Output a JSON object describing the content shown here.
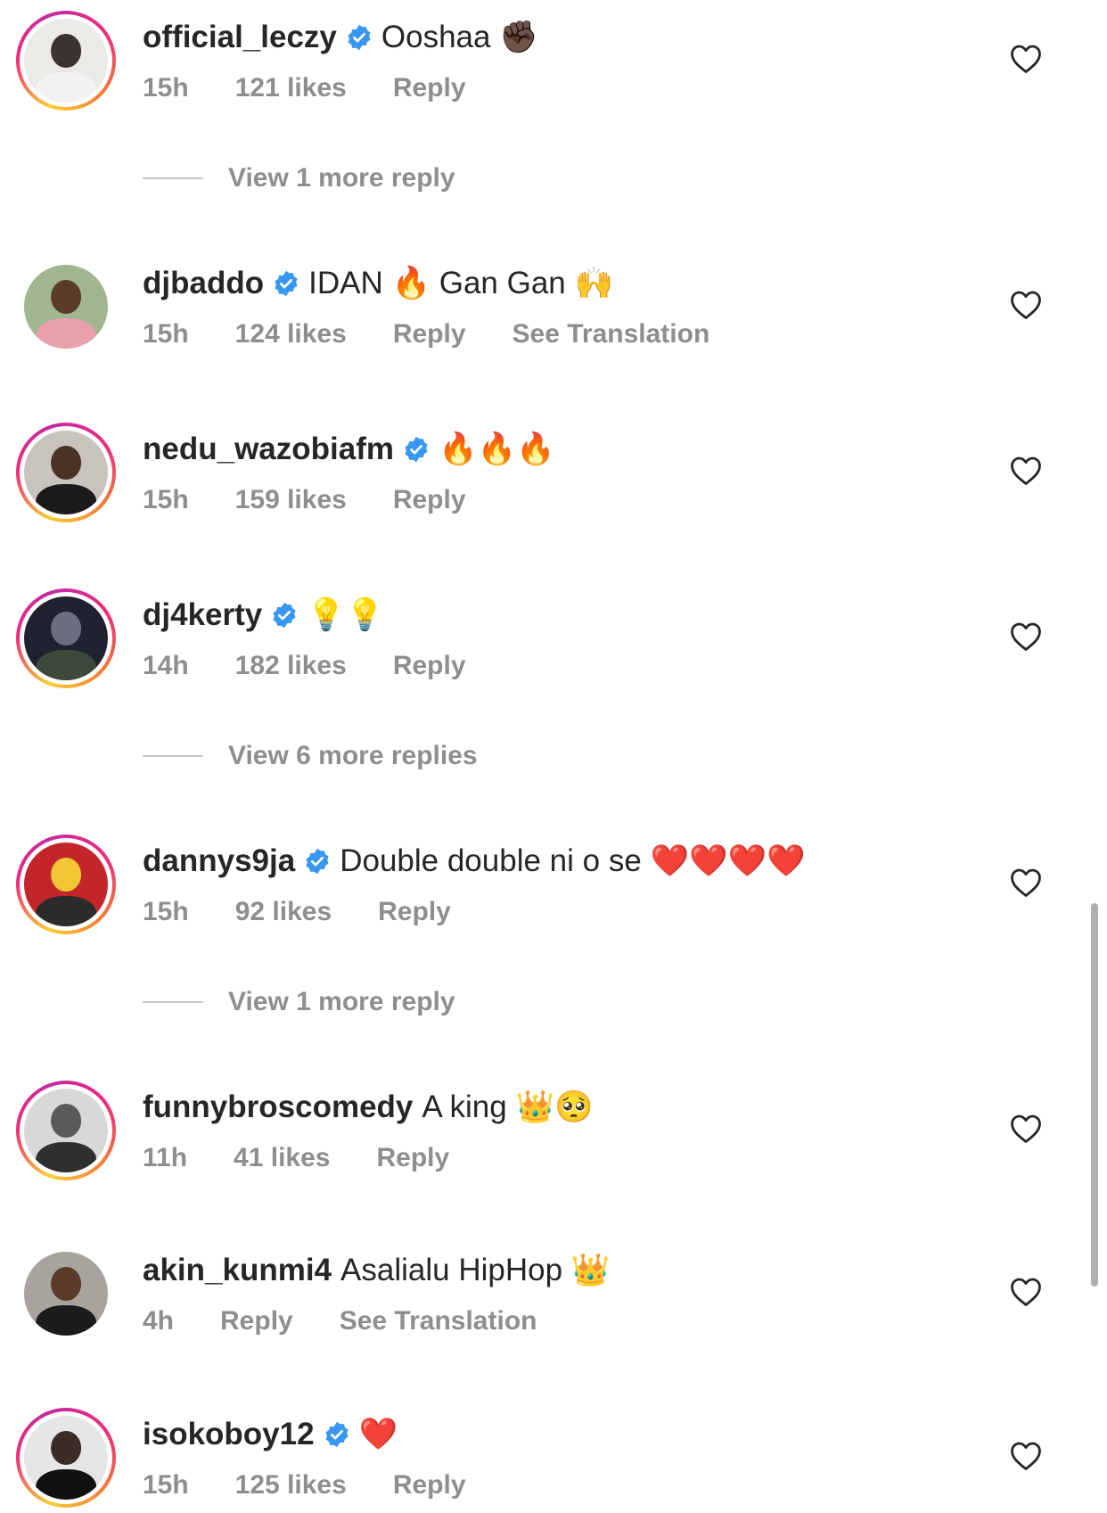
{
  "comments": [
    {
      "username": "official_leczy",
      "verified": true,
      "text": "Ooshaa ✊🏿",
      "time": "15h",
      "likes": "121 likes",
      "reply": "Reply",
      "translate": "",
      "view_more": "View 1 more reply"
    },
    {
      "username": "djbaddo",
      "verified": true,
      "text": "IDAN 🔥 Gan Gan 🙌",
      "time": "15h",
      "likes": "124 likes",
      "reply": "Reply",
      "translate": "See Translation",
      "view_more": ""
    },
    {
      "username": "nedu_wazobiafm",
      "verified": true,
      "text": "🔥🔥🔥",
      "time": "15h",
      "likes": "159 likes",
      "reply": "Reply",
      "translate": "",
      "view_more": ""
    },
    {
      "username": "dj4kerty",
      "verified": true,
      "text": "💡💡",
      "time": "14h",
      "likes": "182 likes",
      "reply": "Reply",
      "translate": "",
      "view_more": "View 6 more replies"
    },
    {
      "username": "dannys9ja",
      "verified": true,
      "text": "Double double ni o se ❤️❤️❤️❤️",
      "time": "15h",
      "likes": "92 likes",
      "reply": "Reply",
      "translate": "",
      "view_more": "View 1 more reply"
    },
    {
      "username": "funnybroscomedy",
      "verified": false,
      "text": "A king 👑🥺",
      "time": "11h",
      "likes": "41 likes",
      "reply": "Reply",
      "translate": "",
      "view_more": ""
    },
    {
      "username": "akin_kunmi4",
      "verified": false,
      "text": "Asalialu HipHop 👑",
      "time": "4h",
      "likes": "",
      "reply": "Reply",
      "translate": "See Translation",
      "view_more": ""
    },
    {
      "username": "isokoboy12",
      "verified": true,
      "text": "❤️",
      "time": "15h",
      "likes": "125 likes",
      "reply": "Reply",
      "translate": "",
      "view_more": ""
    }
  ],
  "colors": {
    "verified_blue": "#3897f0",
    "meta_gray": "#8e8e8e",
    "text_dark": "#262626"
  },
  "icons": {
    "like": "heart-outline-icon",
    "verified": "verified-badge-icon"
  }
}
